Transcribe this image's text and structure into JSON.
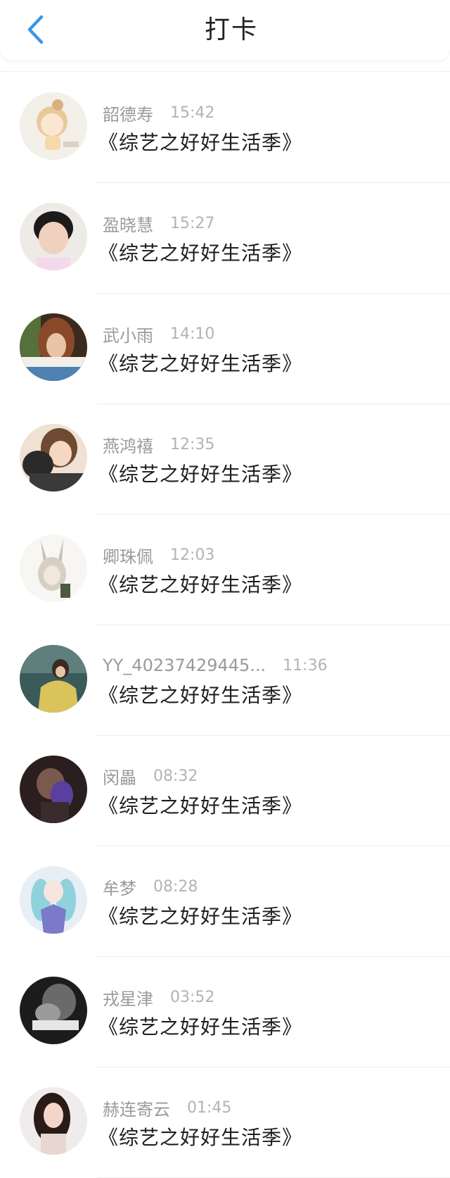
{
  "header": {
    "title": "打卡",
    "back_icon": "chevron-left-icon",
    "accent": "#3c96e8"
  },
  "entries": [
    {
      "name": "韶德寿",
      "time": "15:42",
      "title": "《综艺之好好生活季》"
    },
    {
      "name": "盈晓慧",
      "time": "15:27",
      "title": "《综艺之好好生活季》"
    },
    {
      "name": "武小雨",
      "time": "14:10",
      "title": "《综艺之好好生活季》"
    },
    {
      "name": "燕鸿禧",
      "time": "12:35",
      "title": "《综艺之好好生活季》"
    },
    {
      "name": "卿珠佩",
      "time": "12:03",
      "title": "《综艺之好好生活季》"
    },
    {
      "name": "YY_40237429445...",
      "time": "11:36",
      "title": "《综艺之好好生活季》"
    },
    {
      "name": "闵畾",
      "time": "08:32",
      "title": "《综艺之好好生活季》"
    },
    {
      "name": "牟梦",
      "time": "08:28",
      "title": "《综艺之好好生活季》"
    },
    {
      "name": "戎星津",
      "time": "03:52",
      "title": "《综艺之好好生活季》"
    },
    {
      "name": "赫连寄云",
      "time": "01:45",
      "title": "《综艺之好好生活季》"
    }
  ]
}
